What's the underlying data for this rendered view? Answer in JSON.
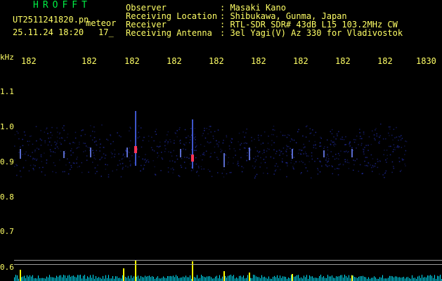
{
  "header": {
    "app_title": "HROFFT",
    "file_name": "UT2511241820.pn",
    "meteor_label": "meteor",
    "datetime": "25.11.24 18:20",
    "meteor_count": "17_"
  },
  "station": {
    "labels": [
      "Observer",
      "Receiving Location",
      "Receiver",
      "Receiving Antenna"
    ],
    "values": [
      ": Masaki Kano",
      ": Shibukawa, Gunma, Japan",
      ": RTL-SDR SDR# 43dB L15 103.2MHz CW",
      ": 3el Yagi(V) Az 330 for Vladivostok"
    ]
  },
  "axis": {
    "unit": "kHz",
    "x_ticks": [
      "182",
      "182",
      "182",
      "182",
      "182",
      "182",
      "182",
      "182",
      "182",
      "1830"
    ],
    "y_ticks": [
      "1.1",
      "1.0",
      "0.9",
      "0.8",
      "0.7",
      "0.6"
    ]
  },
  "colors": {
    "text": "#ffff66",
    "title": "#00ee44",
    "noise": "#1f2a9c",
    "spectrum": "#00e5ff",
    "peak": "#ffff00",
    "echo": "#ff3355"
  }
}
